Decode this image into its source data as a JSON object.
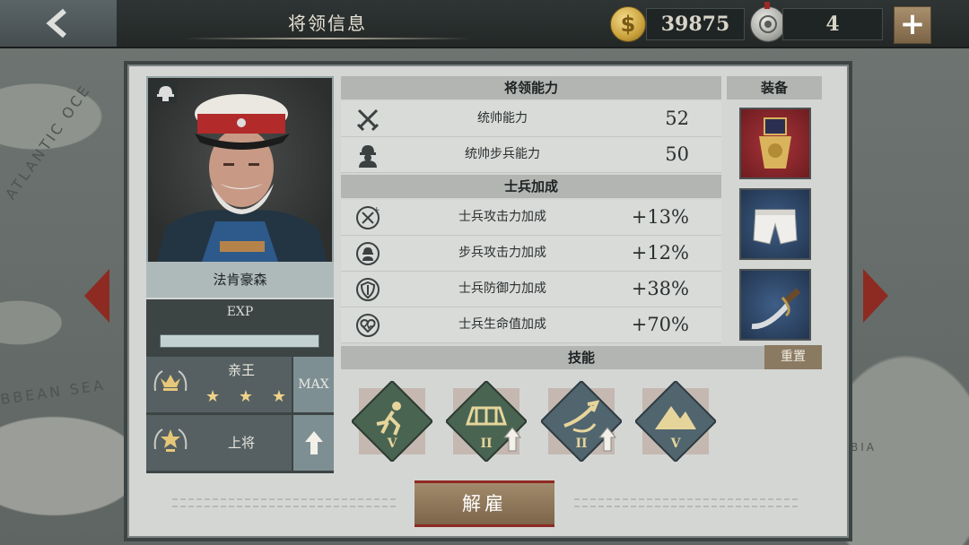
{
  "header": {
    "back_icon": "chevron-left-icon",
    "title": "将领信息",
    "gold_icon": "dollar-coin-icon",
    "gold": "39875",
    "medal_icon": "medal-icon",
    "medals": "4",
    "plus_label": "+"
  },
  "general": {
    "portrait_alt": "general-portrait",
    "class_icon": "infantry-helmet-icon",
    "name": "法肯豪森",
    "exp_label": "EXP",
    "exp_fill": 1.0,
    "title_rank": "亲王",
    "stars": [
      "★",
      "★",
      "★"
    ],
    "title_max": "MAX",
    "military_rank": "上将",
    "upgrade_icon": "upgrade-arrow-icon"
  },
  "abilities": {
    "header": "将领能力",
    "rows": [
      {
        "icon": "crossed-swords-icon",
        "label": "统帅能力",
        "value": "52"
      },
      {
        "icon": "infantry-soldier-icon",
        "label": "统帅步兵能力",
        "value": "50"
      }
    ]
  },
  "bonuses": {
    "header": "士兵加成",
    "rows": [
      {
        "icon": "attack-plus-icon",
        "label": "士兵攻击力加成",
        "value": "+13%"
      },
      {
        "icon": "infantry-attack-plus-icon",
        "label": "步兵攻击力加成",
        "value": "+12%"
      },
      {
        "icon": "shield-plus-icon",
        "label": "士兵防御力加成",
        "value": "+38%"
      },
      {
        "icon": "heart-plus-icon",
        "label": "士兵生命值加成",
        "value": "+70%"
      }
    ]
  },
  "equipment": {
    "header": "装备",
    "items": [
      "medal-equipment",
      "shorts-equipment",
      "saber-equipment"
    ]
  },
  "skills": {
    "header": "技能",
    "reset_label": "重置",
    "items": [
      {
        "icon": "running-soldier-skill",
        "level": "V",
        "upgradable": false
      },
      {
        "icon": "fortification-skill",
        "level": "II",
        "upgradable": true
      },
      {
        "icon": "ambush-skill",
        "level": "II",
        "upgradable": true
      },
      {
        "icon": "mountain-skill",
        "level": "V",
        "upgradable": false
      }
    ]
  },
  "footer": {
    "fire_label": "解雇"
  },
  "map": {
    "label1": "ATLANTIC OCE",
    "label2": "BBEAN SEA",
    "label3": "BIA"
  },
  "colors": {
    "accent_red": "#8d2b22",
    "skill_green": "#4a6452",
    "skill_blue": "#51656f",
    "button_tan": "#a28a6c"
  }
}
